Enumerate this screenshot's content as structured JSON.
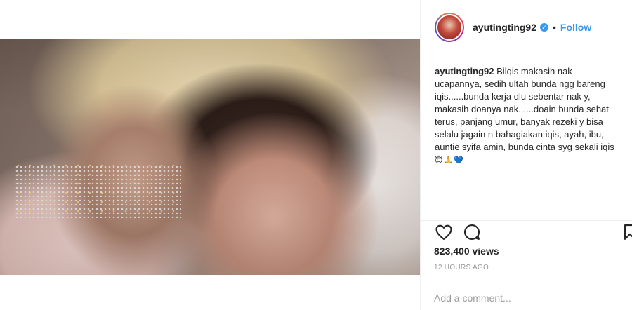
{
  "post": {
    "username": "ayutingting92",
    "verified_icon": "verified-check-icon",
    "separator": "•",
    "follow_label": "Follow",
    "caption_user": "ayutingting92",
    "caption_text": "Bilqis makasih nak ucapannya, sedih ultah bunda ngg bareng iqis......bunda kerja dlu sebentar nak y, makasih doanya nak......doain bunda sehat terus, panjang umur, banyak rezeki y bisa selalu jagain n bahagiakan iqis, ayah, ibu, auntie syifa amin, bunda cinta syg sekali iqis",
    "caption_emojis": "😇🙏💙",
    "views": "823,400 views",
    "timestamp": "12 HOURS AGO",
    "comment_placeholder": "Add a comment..."
  },
  "icons": {
    "like": "heart-icon",
    "comment": "comment-icon",
    "save": "bookmark-icon"
  },
  "colors": {
    "link_blue": "#3897f0",
    "text": "#262626",
    "muted": "#999999",
    "border": "#efefef"
  }
}
